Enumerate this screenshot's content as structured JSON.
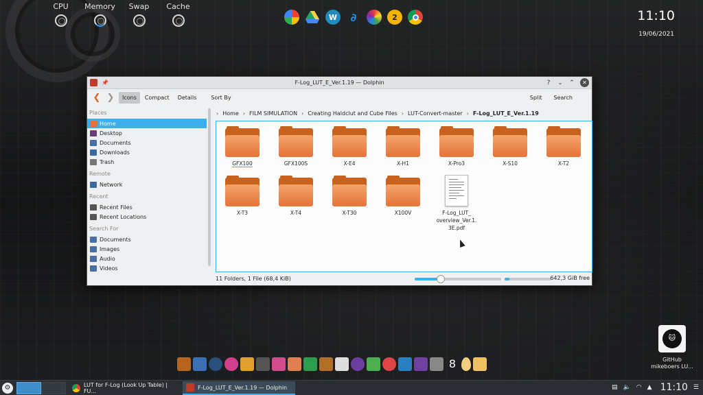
{
  "system_monitor": {
    "labels": [
      "CPU",
      "Memory",
      "Swap",
      "Cache"
    ]
  },
  "top_launcher": [
    "photos-icon",
    "drive-icon",
    "wordpress-icon",
    "blue-app-icon",
    "color-wheel-icon",
    "number-2-icon",
    "chrome-icon"
  ],
  "clock": {
    "time": "11:10",
    "date": "19/06/2021"
  },
  "window": {
    "title": "F-Log_LUT_E_Ver.1.19 — Dolphin",
    "help_btn": "?",
    "toolbar": {
      "view_icons": "Icons",
      "view_compact": "Compact",
      "view_details": "Details",
      "sort_by": "Sort By",
      "split": "Split",
      "search": "Search"
    },
    "places": {
      "sections": {
        "places": "Places",
        "remote": "Remote",
        "recent": "Recent",
        "search_for": "Search For"
      },
      "places_items": [
        {
          "label": "Home",
          "selected": true,
          "color": "#e5733a"
        },
        {
          "label": "Desktop",
          "color": "#6b3a7a"
        },
        {
          "label": "Documents",
          "color": "#4a6fa5"
        },
        {
          "label": "Downloads",
          "color": "#3a6aa0"
        },
        {
          "label": "Trash",
          "color": "#777777"
        }
      ],
      "remote_items": [
        {
          "label": "Network",
          "color": "#3a6aa0"
        }
      ],
      "recent_items": [
        {
          "label": "Recent Files",
          "color": "#555555"
        },
        {
          "label": "Recent Locations",
          "color": "#555555"
        }
      ],
      "search_items": [
        {
          "label": "Documents",
          "color": "#4a6fa5"
        },
        {
          "label": "Images",
          "color": "#4a6fa5"
        },
        {
          "label": "Audio",
          "color": "#4a6fa5"
        },
        {
          "label": "Videos",
          "color": "#4a6fa5"
        }
      ]
    },
    "breadcrumb": [
      "Home",
      "FILM SIMULATION",
      "Creating Haldclut and Cube Files",
      "LUT-Convert-master",
      "F-Log_LUT_E_Ver.1.19"
    ],
    "folders": [
      "GFX100",
      "GFX100S",
      "X-E4",
      "X-H1",
      "X-Pro3",
      "X-S10",
      "X-T2",
      "X-T3",
      "X-T4",
      "X-T30",
      "X100V"
    ],
    "file": {
      "name_line1": "F-Log_LUT_",
      "name_line2": "overview_Ver.1.",
      "name_line3": "3E.pdf"
    },
    "status": {
      "summary": "11 Folders, 1 File (68,4 KiB)",
      "zoom_level": 0.3,
      "disk_used": 0.1,
      "free": "642,3 GiB free"
    }
  },
  "github_widget": {
    "line1": "GitHub",
    "line2": "mikeboers LU..."
  },
  "dock_icons": [
    "file-manager-icon",
    "stack-icon",
    "globe-icon",
    "color-icon",
    "image-viewer-icon",
    "gimp-icon",
    "paint-icon",
    "map-icon",
    "greenshot-icon",
    "film-icon",
    "inkscape-icon",
    "eye-icon",
    "folder-green-icon",
    "pinwheel-icon",
    "spiral-icon",
    "video-icon",
    "vlc-like-icon",
    "number-8-icon",
    "egg-icon",
    "corner-icon"
  ],
  "taskbar": {
    "tasks": [
      {
        "label": "LUT for F-Log (Look Up Table) | FU...",
        "active": false
      },
      {
        "label": "F-Log_LUT_E_Ver.1.19 — Dolphin",
        "active": true
      }
    ],
    "clock": "11:10"
  },
  "colors": {
    "accent": "#3daee9",
    "folder": "#e5733a",
    "panel": "#2a2e32"
  }
}
